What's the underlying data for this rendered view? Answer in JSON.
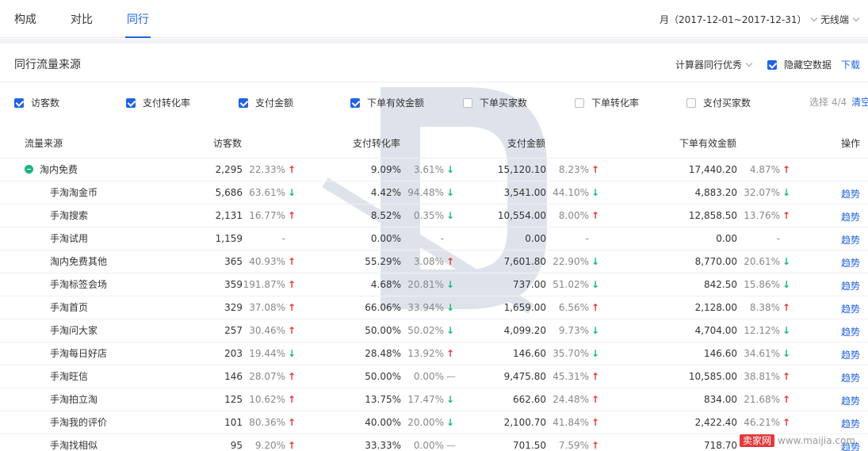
{
  "tabs": [
    {
      "label": "构成",
      "active": false
    },
    {
      "label": "对比",
      "active": false
    },
    {
      "label": "同行",
      "active": true
    }
  ],
  "header": {
    "date_range": "月（2017-12-01~2017-12-31）",
    "device": "无线端"
  },
  "section": {
    "title": "同行流量来源",
    "calc_label": "计算器同行优秀",
    "hide_empty_label": "隐藏空数据",
    "hide_empty_checked": true,
    "download_label": "下载"
  },
  "metrics": [
    {
      "label": "访客数",
      "checked": true
    },
    {
      "label": "支付转化率",
      "checked": true
    },
    {
      "label": "支付金额",
      "checked": true
    },
    {
      "label": "下单有效金额",
      "checked": true
    },
    {
      "label": "下单买家数",
      "checked": false
    },
    {
      "label": "下单转化率",
      "checked": false
    },
    {
      "label": "支付买家数",
      "checked": false
    }
  ],
  "selection": {
    "text": "选择 4/4",
    "clear": "清空"
  },
  "columns": {
    "source": "流量来源",
    "visitors": "访客数",
    "pay_rate": "支付转化率",
    "pay_amount": "支付金额",
    "order_amount": "下单有效金额",
    "action": "操作"
  },
  "trend_label": "趋势",
  "rows": [
    {
      "source": "淘内免费",
      "parent": true,
      "visitors": "2,295",
      "v_pct": "22.33%",
      "v_dir": "up",
      "pay_rate": "9.09%",
      "r_pct": "3.61%",
      "r_dir": "down",
      "pay_amount": "15,120.10",
      "a_pct": "8.23%",
      "a_dir": "up",
      "order_amount": "17,440.20",
      "o_pct": "4.87%",
      "o_dir": "up"
    },
    {
      "source": "手淘淘金币",
      "visitors": "5,686",
      "v_pct": "63.61%",
      "v_dir": "down",
      "pay_rate": "4.42%",
      "r_pct": "94.48%",
      "r_dir": "down",
      "pay_amount": "3,541.00",
      "a_pct": "44.10%",
      "a_dir": "down",
      "order_amount": "4,883.20",
      "o_pct": "32.07%",
      "o_dir": "down"
    },
    {
      "source": "手淘搜索",
      "visitors": "2,131",
      "v_pct": "16.77%",
      "v_dir": "up",
      "pay_rate": "8.52%",
      "r_pct": "0.35%",
      "r_dir": "down",
      "pay_amount": "10,554.00",
      "a_pct": "8.00%",
      "a_dir": "up",
      "order_amount": "12,858.50",
      "o_pct": "13.76%",
      "o_dir": "up"
    },
    {
      "source": "手淘试用",
      "visitors": "1,159",
      "v_pct": "-",
      "v_dir": "none",
      "pay_rate": "0.00%",
      "r_pct": "-",
      "r_dir": "none",
      "pay_amount": "0.00",
      "a_pct": "-",
      "a_dir": "none",
      "order_amount": "0.00",
      "o_pct": "-",
      "o_dir": "none"
    },
    {
      "source": "淘内免费其他",
      "visitors": "365",
      "v_pct": "40.93%",
      "v_dir": "up",
      "pay_rate": "55.29%",
      "r_pct": "3.08%",
      "r_dir": "up",
      "pay_amount": "7,601.80",
      "a_pct": "22.90%",
      "a_dir": "down",
      "order_amount": "8,770.00",
      "o_pct": "20.61%",
      "o_dir": "down"
    },
    {
      "source": "手淘标签会场",
      "visitors": "359",
      "v_pct": "191.87%",
      "v_dir": "up",
      "pay_rate": "4.68%",
      "r_pct": "20.81%",
      "r_dir": "down",
      "pay_amount": "737.00",
      "a_pct": "51.02%",
      "a_dir": "down",
      "order_amount": "842.50",
      "o_pct": "15.86%",
      "o_dir": "down"
    },
    {
      "source": "手淘首页",
      "visitors": "329",
      "v_pct": "37.08%",
      "v_dir": "up",
      "pay_rate": "66.06%",
      "r_pct": "33.94%",
      "r_dir": "down",
      "pay_amount": "1,659.00",
      "a_pct": "6.56%",
      "a_dir": "up",
      "order_amount": "2,128.00",
      "o_pct": "8.38%",
      "o_dir": "up"
    },
    {
      "source": "手淘问大家",
      "visitors": "257",
      "v_pct": "30.46%",
      "v_dir": "up",
      "pay_rate": "50.00%",
      "r_pct": "50.02%",
      "r_dir": "down",
      "pay_amount": "4,099.20",
      "a_pct": "9.73%",
      "a_dir": "down",
      "order_amount": "4,704.00",
      "o_pct": "12.12%",
      "o_dir": "down"
    },
    {
      "source": "手淘每日好店",
      "visitors": "203",
      "v_pct": "19.44%",
      "v_dir": "down",
      "pay_rate": "28.48%",
      "r_pct": "13.92%",
      "r_dir": "up",
      "pay_amount": "146.60",
      "a_pct": "35.70%",
      "a_dir": "down",
      "order_amount": "146.60",
      "o_pct": "34.61%",
      "o_dir": "down"
    },
    {
      "source": "手淘旺信",
      "visitors": "146",
      "v_pct": "28.07%",
      "v_dir": "up",
      "pay_rate": "50.00%",
      "r_pct": "0.00%",
      "r_dir": "flat",
      "pay_amount": "9,475.80",
      "a_pct": "45.31%",
      "a_dir": "up",
      "order_amount": "10,585.00",
      "o_pct": "38.81%",
      "o_dir": "up"
    },
    {
      "source": "手淘拍立淘",
      "visitors": "125",
      "v_pct": "10.62%",
      "v_dir": "up",
      "pay_rate": "13.75%",
      "r_pct": "17.47%",
      "r_dir": "down",
      "pay_amount": "662.60",
      "a_pct": "24.48%",
      "a_dir": "up",
      "order_amount": "834.00",
      "o_pct": "21.68%",
      "o_dir": "up"
    },
    {
      "source": "手淘我的评价",
      "visitors": "101",
      "v_pct": "80.36%",
      "v_dir": "up",
      "pay_rate": "40.00%",
      "r_pct": "20.00%",
      "r_dir": "down",
      "pay_amount": "2,100.70",
      "a_pct": "41.84%",
      "a_dir": "up",
      "order_amount": "2,422.40",
      "o_pct": "46.21%",
      "o_dir": "up"
    },
    {
      "source": "手淘找相似",
      "visitors": "95",
      "v_pct": "9.20%",
      "v_dir": "up",
      "pay_rate": "33.33%",
      "r_pct": "0.00%",
      "r_dir": "flat",
      "pay_amount": "701.50",
      "a_pct": "7.59%",
      "a_dir": "up",
      "order_amount": "718.70",
      "o_pct": "",
      "o_dir": "none"
    }
  ],
  "watermark": {
    "brand": "卖家网",
    "url": "www.maijia.com"
  },
  "colors": {
    "accent": "#2062e6",
    "up": "#e4393c",
    "down": "#17b978"
  }
}
